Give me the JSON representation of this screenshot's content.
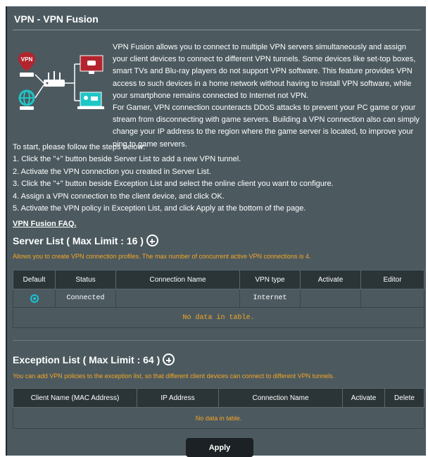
{
  "page": {
    "title": "VPN - VPN Fusion",
    "hero_label": "VPN",
    "intro": [
      "VPN Fusion allows you to connect to multiple VPN servers simultaneously and assign your client devices to connect to different VPN tunnels. Some devices like set-top boxes, smart TVs and Blu-ray players do not support VPN software. This feature provides VPN access to such devices in a home network without having to install VPN software, while your smartphone remains connected to Internet not VPN.",
      "For Gamer, VPN connection counteracts DDoS attacks to prevent your PC game or your stream from disconnecting with game servers. Building a VPN connection also can simply change your IP address to the region where the game server is located, to improve your ping to game servers."
    ],
    "steps_intro": "To start, please follow the steps below:",
    "steps": [
      "1. Click the \"+\" button beside Server List to add a new VPN tunnel.",
      "2. Activate the VPN connection you created in Server List.",
      "3. Click the \"+\" button beside Exception List and select the online client you want to configure.",
      "4. Assign a VPN connection to the client device, and click OK.",
      "5. Activate the VPN policy in Exception List, and click Apply at the bottom of the page."
    ],
    "faq_link": "VPN Fusion FAQ."
  },
  "server_list": {
    "title": "Server List ( Max Limit : 16 )",
    "note": "Allows you to create VPN connection profiles. The max number of concurrent active VPN connections is 4.",
    "columns": [
      "Default",
      "Status",
      "Connection Name",
      "VPN type",
      "Activate",
      "Editor"
    ],
    "rows": [
      {
        "status": "Connected",
        "connection_name": "",
        "vpn_type": "Internet",
        "activate": "",
        "editor": ""
      }
    ],
    "empty_message": "No data in table."
  },
  "exception_list": {
    "title": "Exception List ( Max Limit : 64 )",
    "note": "You can add VPN policies to the exception list, so that different client devices can connect to different VPN tunnels.",
    "columns": [
      "Client Name (MAC Address)",
      "IP Address",
      "Connection Name",
      "Activate",
      "Delete"
    ],
    "empty_message": "No data in table."
  },
  "apply_label": "Apply",
  "colors": {
    "panel_bg": "#4c5a60",
    "header_bg": "#2b3538",
    "note_orange": "#f5a623",
    "radio_cyan": "#19c3d8",
    "hero_red": "#b3252e",
    "hero_teal": "#1ec6c6"
  }
}
